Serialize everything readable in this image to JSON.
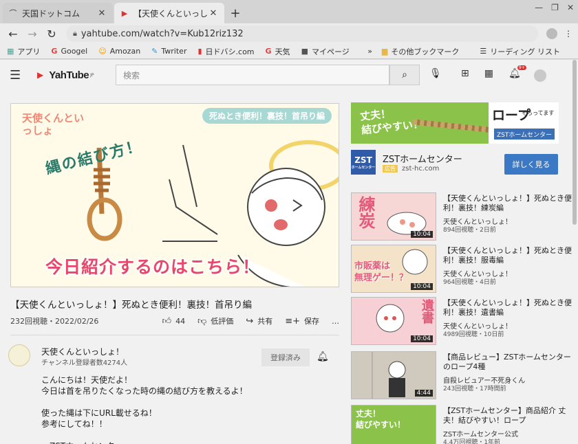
{
  "browser": {
    "tabs": [
      {
        "title": "天国ドットコム",
        "close": "✕",
        "active": false
      },
      {
        "title": "【天使くんといっしょ",
        "close": "✕",
        "active": true
      }
    ],
    "new_tab": "+",
    "url": "yahtube.com/watch?v=Kub12riz132",
    "bookmarks": [
      {
        "icon": "▦",
        "label": "アプリ"
      },
      {
        "icon": "G",
        "label": "Googel"
      },
      {
        "icon": "☺",
        "label": "Amozan"
      },
      {
        "icon": "✎",
        "label": "Twriter"
      },
      {
        "icon": "▮",
        "label": "日ドバシ.com"
      },
      {
        "icon": "G",
        "label": "天気"
      },
      {
        "icon": "■",
        "label": "マイページ"
      }
    ],
    "bookmarks_overflow": "»",
    "other_bookmarks": "その他ブックマーク",
    "reading_list": "リーディング リスト"
  },
  "site": {
    "logo": "YahTube",
    "logo_suffix": "JP",
    "search_placeholder": "検索",
    "notification_count": "9+"
  },
  "video": {
    "thumb_tag": "死ぬとき便利！裏技！首吊り編",
    "thumb_brand": "天使くんといっしょ",
    "thumb_heading": "縄の結び方！",
    "thumb_caption": "今日紹介するのはこちら！",
    "title": "【天使くんといっしょ！】死ぬとき便利！裏技！首吊り編",
    "views_date": "232回視聴・2022/02/26",
    "likes": "44",
    "dislike": "低評価",
    "share": "共有",
    "save": "保存",
    "more": "…"
  },
  "channel": {
    "name": "天使くんといっしょ！",
    "subscribers": "チャンネル登録者数4274人",
    "subscribed_label": "登録済み",
    "description": "こんにちは！天使だよ！\n今日は首を吊りたくなった時の縄の結び方を教えるよ！\n\n使った縄は下にURL載せるね！\n参考にしてね！！\n\n・ZSTホームセンター\n  https://zst-hc.com"
  },
  "ad": {
    "banner_left": "丈夫！\n結びやすい！",
    "banner_rope": "ロープ",
    "banner_sub": "そろってます",
    "banner_brand": "ZSTホームセンター",
    "logo_text": "ZST",
    "logo_sub": "ホームセンター",
    "name": "ZSTホームセンター",
    "badge": "広告",
    "domain": "zst-hc.com",
    "cta": "詳しく見る"
  },
  "recommendations": [
    {
      "title": "【天使くんといっしょ！】死ぬとき便利！裏技！練炭編",
      "channel": "天使くんといっしょ！",
      "meta": "894回視聴・2日前",
      "duration": "10:04",
      "thumb_text": "練炭",
      "thumb_color": "#f7d6d6",
      "label_color": "#e35b7a"
    },
    {
      "title": "【天使くんといっしょ！】死ぬとき便利！裏技！服毒編",
      "channel": "天使くんといっしょ！",
      "meta": "964回視聴・4日前",
      "duration": "10:04",
      "thumb_text": "市販薬は\n無理ゲー！？",
      "thumb_color": "#f4e3c8",
      "label_color": "#e35b7a"
    },
    {
      "title": "【天使くんといっしょ！】死ぬとき便利！裏技！遺書編",
      "channel": "天使くんといっしょ！",
      "meta": "4989回視聴・10日前",
      "duration": "10:04",
      "thumb_text": "遺書",
      "thumb_color": "#f7d0d6",
      "label_color": "#e35b7a"
    },
    {
      "title": "【商品レビュー】ZSTホームセンターのロープ4種",
      "channel": "自殺レビュアー不死身くん",
      "meta": "243回視聴・17時間前",
      "duration": "4:44",
      "thumb_text": "",
      "thumb_color": "#d9d6cc",
      "label_color": "#ffffff"
    },
    {
      "title": "【ZSTホームセンター】商品紹介 丈夫！結びやすい！ロープ",
      "channel": "ZSTホームセンター公式",
      "meta": "4.4万回視聴・1年前",
      "duration": "",
      "thumb_text": "丈夫！\n結びやすい！",
      "thumb_color": "#8bc34a",
      "label_color": "#ffffff"
    }
  ]
}
